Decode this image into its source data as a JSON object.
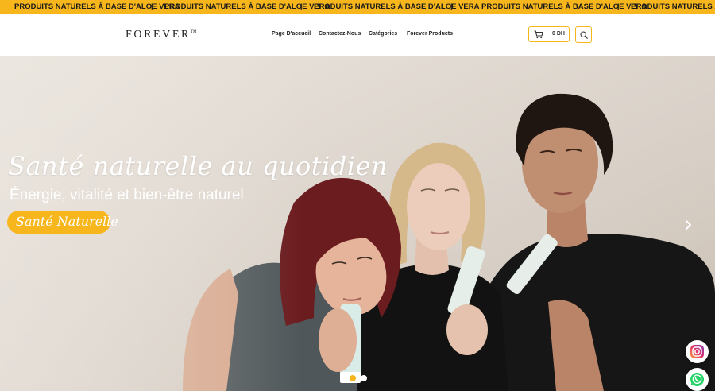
{
  "marquee": {
    "items": [
      "PRODUITS NATURELS À BASE D'ALOE VERA",
      "PRODUITS NATURELS À BASE D'ALOE VERA",
      "PRODUITS NATURELS À BASE D'ALOE VERA",
      "PRODUITS NATURELS À BASE D'ALOE VERA",
      "PRODUITS NATURELS À BASE D'ALOE VERA"
    ],
    "separator": "|"
  },
  "header": {
    "logo": "FOREVER",
    "logo_tm": "TM",
    "nav": [
      "Page D'accueil",
      "Contactez-Nous",
      "Catégories",
      "Forever Products"
    ],
    "cart_total": "0 DH"
  },
  "hero": {
    "title": "Santé naturelle au quotidien",
    "subtitle": "Énergie, vitalité et bien-être naturel",
    "pill": "Santé Naturelle",
    "slides_total": 2,
    "active_slide": 1
  },
  "colors": {
    "accent": "#f6b61c",
    "text_dark": "#1b1b1b"
  },
  "icons": {
    "cart": "cart-icon",
    "search": "search-icon",
    "next": "chevron-right-icon",
    "instagram": "instagram-icon",
    "whatsapp": "whatsapp-icon"
  }
}
